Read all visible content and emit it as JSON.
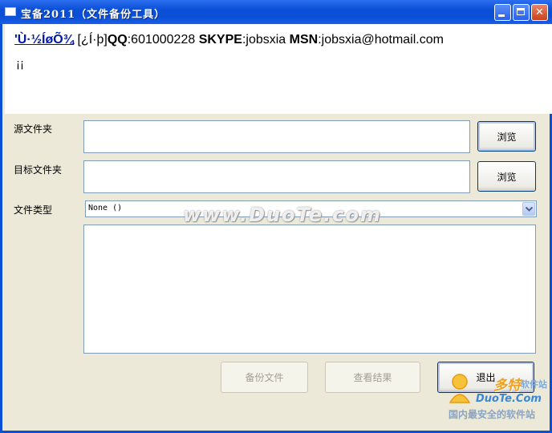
{
  "window": {
    "title": "宝备2011（文件备份工具）"
  },
  "titlebar_buttons": {
    "minimize": "minimize-icon",
    "maximize": "maximize-icon",
    "close": "✕"
  },
  "header": {
    "link": "'Ù·½ÍøÕ¾",
    "bracket": " [¿Í·þ]",
    "qq_label": "QQ",
    "qq_value": ":601000228 ",
    "skype_label": "SKYPE",
    "skype_value": ":jobsxia ",
    "msn_label": "MSN",
    "msn_value": ":jobsxia@hotmail.com",
    "line2": "¡¡"
  },
  "form": {
    "source_label": "源文件夹",
    "source_value": "",
    "browse1": "浏览",
    "target_label": "目标文件夹",
    "target_value": "",
    "browse2": "浏览",
    "type_label": "文件类型",
    "type_value": "None ()"
  },
  "actions": {
    "backup": "备份文件",
    "view": "查看结果",
    "exit": "退出"
  },
  "watermark": "www.DuoTe.com",
  "logo": {
    "cn": "多特",
    "cn_small": "软件站",
    "en": "DuoTe.Com",
    "tagline": "国内最安全的软件站"
  }
}
